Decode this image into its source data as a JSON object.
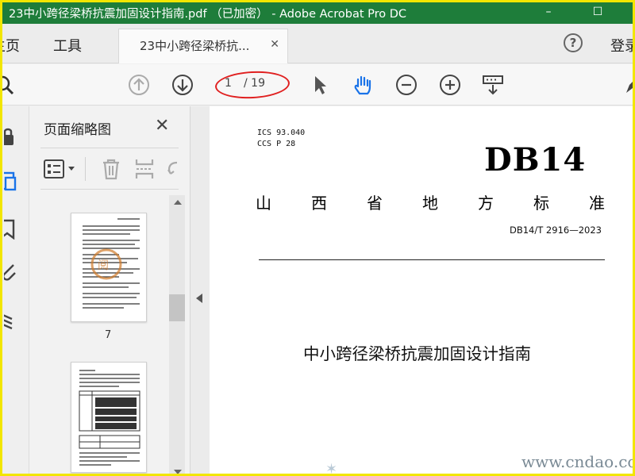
{
  "window": {
    "title": "23中小跨径梁桥抗震加固设计指南.pdf （已加密） - Adobe Acrobat Pro DC",
    "minimize": "–",
    "maximize": "☐"
  },
  "tabs": {
    "home": "主页",
    "tools": "工具",
    "document": "23中小跨径梁桥抗...",
    "close": "✕",
    "help": "?",
    "login": "登录"
  },
  "toolbar": {
    "current_page": "1",
    "total_pages": "/ 19"
  },
  "panel": {
    "title": "页面缩略图",
    "close": "✕",
    "thumbnails": [
      {
        "label": "7"
      },
      {
        "label": ""
      }
    ]
  },
  "document": {
    "ics": "ICS  93.040",
    "ccs": "CCS  P 28",
    "code_big": "DB14",
    "standard_type": [
      "山",
      "西",
      "省",
      "地",
      "方",
      "标",
      "准"
    ],
    "standard_number": "DB14/T 2916—2023",
    "title": "中小跨径梁桥抗震加固设计指南"
  },
  "watermark": {
    "text": "www.cndao.com"
  },
  "colors": {
    "titlebar": "#1e7d3a",
    "frame": "#f2e600",
    "annotation": "#e02020",
    "accent_blue": "#1a73e8"
  }
}
